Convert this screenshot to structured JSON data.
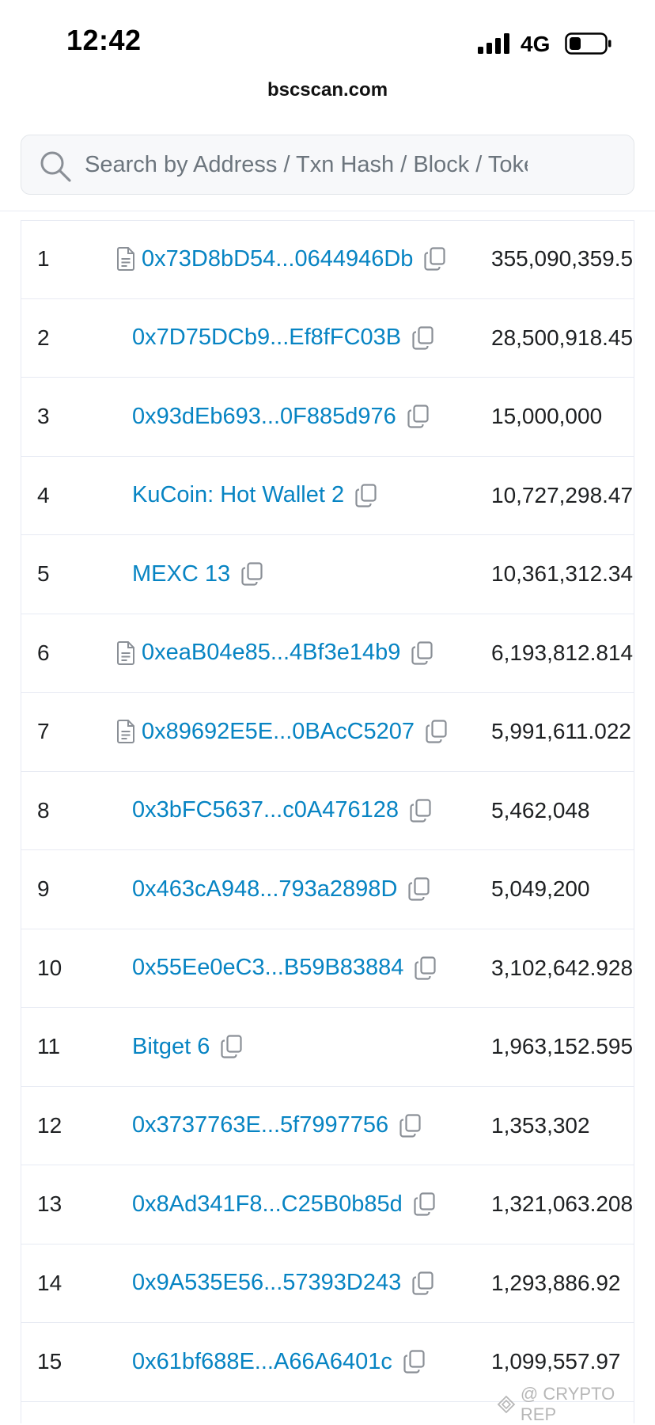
{
  "status_bar": {
    "time": "12:42",
    "network": "4G"
  },
  "browser": {
    "url": "bscscan.com"
  },
  "search": {
    "placeholder": "Search by Address / Txn Hash / Block / Token / Domain Name"
  },
  "holders": {
    "rows": [
      {
        "rank": "1",
        "address": "0x73D8bD54...0644946Db",
        "is_contract": true,
        "quantity": "355,090,359.5"
      },
      {
        "rank": "2",
        "address": "0x7D75DCb9...Ef8fFC03B",
        "is_contract": false,
        "quantity": "28,500,918.45"
      },
      {
        "rank": "3",
        "address": "0x93dEb693...0F885d976",
        "is_contract": false,
        "quantity": "15,000,000"
      },
      {
        "rank": "4",
        "address": "KuCoin: Hot Wallet 2",
        "is_contract": false,
        "quantity": "10,727,298.47"
      },
      {
        "rank": "5",
        "address": "MEXC 13",
        "is_contract": false,
        "quantity": "10,361,312.34"
      },
      {
        "rank": "6",
        "address": "0xeaB04e85...4Bf3e14b9",
        "is_contract": true,
        "quantity": "6,193,812.814"
      },
      {
        "rank": "7",
        "address": "0x89692E5E...0BAcC5207",
        "is_contract": true,
        "quantity": "5,991,611.022"
      },
      {
        "rank": "8",
        "address": "0x3bFC5637...c0A476128",
        "is_contract": false,
        "quantity": "5,462,048"
      },
      {
        "rank": "9",
        "address": "0x463cA948...793a2898D",
        "is_contract": false,
        "quantity": "5,049,200"
      },
      {
        "rank": "10",
        "address": "0x55Ee0eC3...B59B83884",
        "is_contract": false,
        "quantity": "3,102,642.928"
      },
      {
        "rank": "11",
        "address": "Bitget 6",
        "is_contract": false,
        "quantity": "1,963,152.595"
      },
      {
        "rank": "12",
        "address": "0x3737763E...5f7997756",
        "is_contract": false,
        "quantity": "1,353,302"
      },
      {
        "rank": "13",
        "address": "0x8Ad341F8...C25B0b85d",
        "is_contract": false,
        "quantity": "1,321,063.208"
      },
      {
        "rank": "14",
        "address": "0x9A535E56...57393D243",
        "is_contract": false,
        "quantity": "1,293,886.92"
      },
      {
        "rank": "15",
        "address": "0x61bf688E...A66A6401c",
        "is_contract": false,
        "quantity": "1,099,557.97"
      }
    ]
  },
  "watermark": {
    "text": "@ CRYPTO REP"
  },
  "colors": {
    "link": "#0784c3",
    "text": "#1e2022",
    "border": "#e7eaf3"
  },
  "icons": {
    "search": "search-icon",
    "copy": "copy-icon",
    "contract": "contract-file-icon"
  }
}
